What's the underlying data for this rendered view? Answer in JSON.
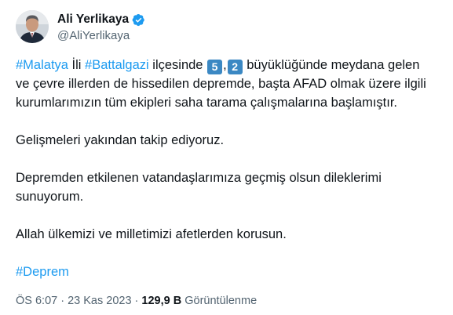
{
  "author": {
    "name": "Ali Yerlikaya",
    "handle": "@AliYerlikaya",
    "verified_color": "#1d9bf0"
  },
  "tweet": {
    "p1": {
      "tag1": "#Malatya",
      "t1": " İli ",
      "tag2": "#Battalgazi",
      "t2": " ilçesinde ",
      "digit1": "5",
      "comma": ",",
      "digit2": "2",
      "t3": " büyüklüğünde meydana gelen",
      "line2": "ve çevre illerden de hissedilen depremde, başta AFAD olmak üzere ilgili",
      "line3": "kurumlarımızın tüm ekipleri saha tarama çalışmalarına başlamıştır."
    },
    "p2": "Gelişmeleri yakından takip ediyoruz.",
    "p3_line1": "Depremden etkilenen vatandaşlarımıza geçmiş olsun dileklerimi",
    "p3_line2": "sunuyorum.",
    "p4": "Allah ülkemizi ve milletimizi afetlerden korusun.",
    "hashtag": "#Deprem"
  },
  "meta": {
    "time": "ÖS 6:07",
    "sep1": " · ",
    "date": "23 Kas 2023",
    "sep2": " · ",
    "views": "129,9 B",
    "views_label": " Görüntülenme"
  },
  "colors": {
    "link": "#1d9bf0",
    "secondary": "#536471",
    "text": "#0f1419",
    "keycap": "#3b88c3"
  }
}
